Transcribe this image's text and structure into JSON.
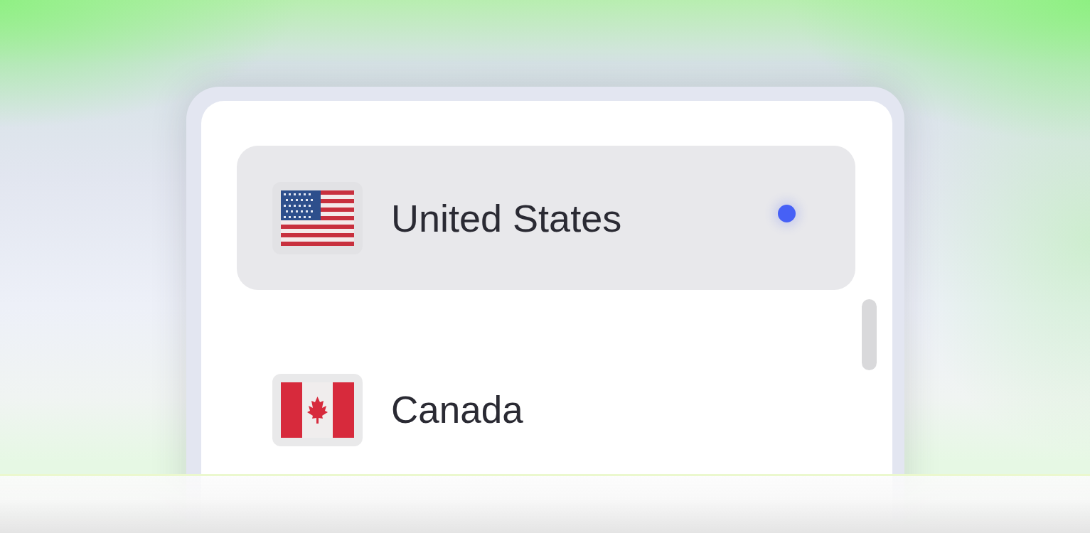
{
  "countries": [
    {
      "name": "United States",
      "kind": "us",
      "selected": true
    },
    {
      "name": "Canada",
      "kind": "ca",
      "selected": false
    }
  ]
}
